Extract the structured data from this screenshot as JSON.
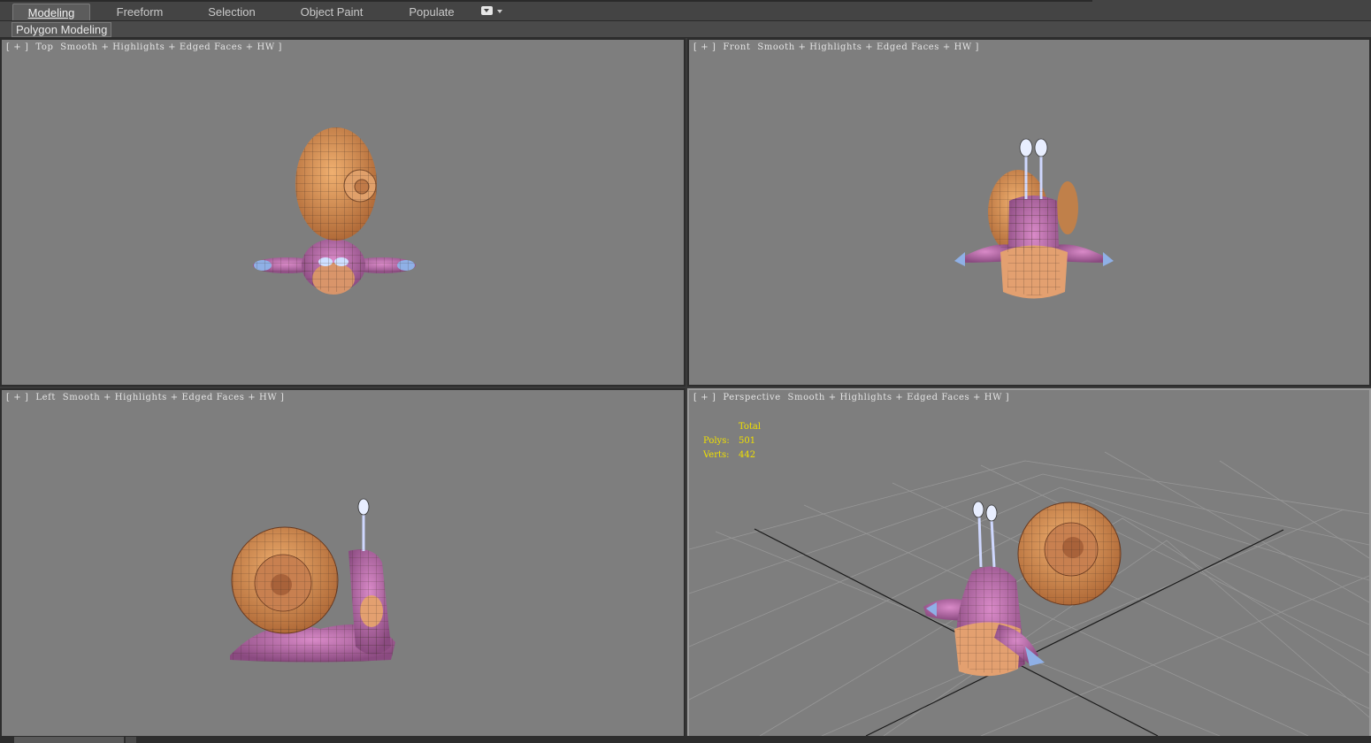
{
  "ribbon": {
    "tabs": [
      {
        "label": "Modeling",
        "active": true
      },
      {
        "label": "Freeform",
        "active": false
      },
      {
        "label": "Selection",
        "active": false
      },
      {
        "label": "Object Paint",
        "active": false
      },
      {
        "label": "Populate",
        "active": false
      }
    ],
    "options_icon": "ribbon-options-icon",
    "panel_label": "Polygon Modeling"
  },
  "viewports": {
    "top": {
      "plus": "[ + ]",
      "view": "Top",
      "shading": "Smooth + Highlights + Edged Faces + HW ]"
    },
    "front": {
      "plus": "[ + ]",
      "view": "Front",
      "shading": "Smooth + Highlights + Edged Faces + HW ]"
    },
    "left": {
      "plus": "[ + ]",
      "view": "Left",
      "shading": "Smooth + Highlights + Edged Faces + HW ]"
    },
    "perspective": {
      "plus": "[ + ]",
      "view": "Perspective",
      "shading": "Smooth + Highlights + Edged Faces + HW ]",
      "stats": {
        "header": "Total",
        "polys_label": "Polys:",
        "polys": "501",
        "verts_label": "Verts:",
        "verts": "442"
      }
    }
  },
  "colors": {
    "viewport_bg": "#7e7e7e",
    "shell": "#d4925a",
    "body": "#b66aa8",
    "accent_blue": "#8fb0e6",
    "stats_yellow": "#f0e000"
  }
}
